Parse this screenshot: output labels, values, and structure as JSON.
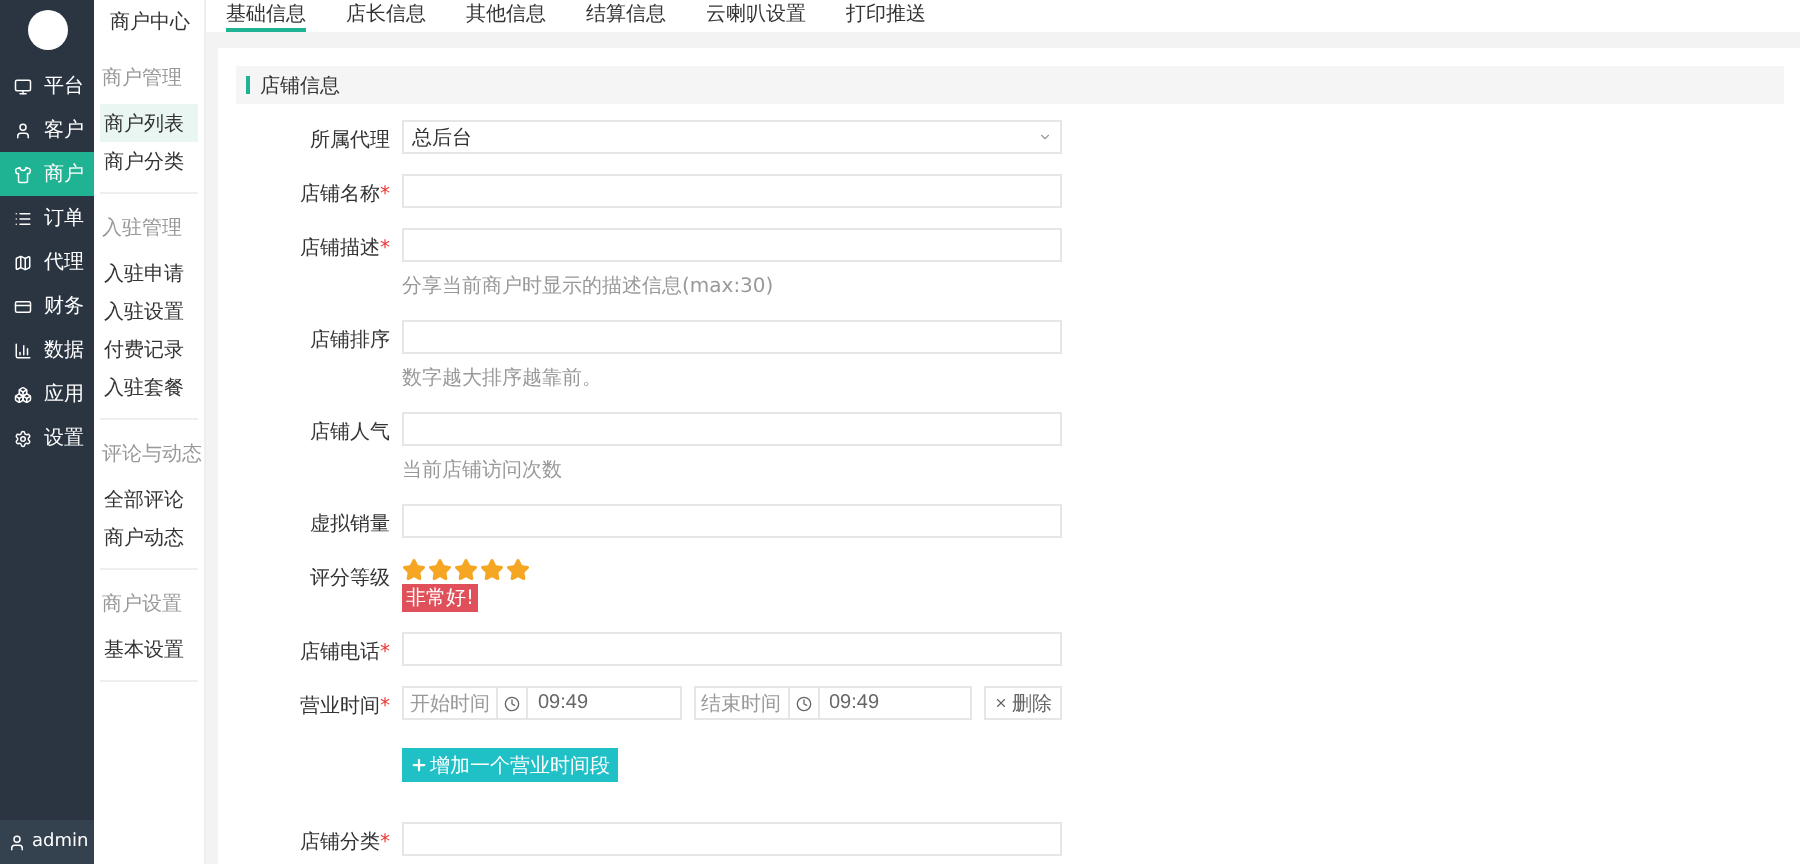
{
  "sidebar": {
    "items": [
      {
        "label": "平台",
        "selected": false
      },
      {
        "label": "客户",
        "selected": false
      },
      {
        "label": "商户",
        "selected": true
      },
      {
        "label": "订单",
        "selected": false
      },
      {
        "label": "代理",
        "selected": false
      },
      {
        "label": "财务",
        "selected": false
      },
      {
        "label": "数据",
        "selected": false
      },
      {
        "label": "应用",
        "selected": false
      },
      {
        "label": "设置",
        "selected": false
      }
    ],
    "user": "admin"
  },
  "submenu": {
    "title": "商户中心",
    "groups": [
      {
        "title": "商户管理",
        "items": [
          {
            "label": "商户列表",
            "selected": true
          },
          {
            "label": "商户分类",
            "selected": false
          }
        ]
      },
      {
        "title": "入驻管理",
        "items": [
          {
            "label": "入驻申请",
            "selected": false
          },
          {
            "label": "入驻设置",
            "selected": false
          },
          {
            "label": "付费记录",
            "selected": false
          },
          {
            "label": "入驻套餐",
            "selected": false
          }
        ]
      },
      {
        "title": "评论与动态",
        "items": [
          {
            "label": "全部评论",
            "selected": false
          },
          {
            "label": "商户动态",
            "selected": false
          }
        ]
      },
      {
        "title": "商户设置",
        "items": [
          {
            "label": "基本设置",
            "selected": false
          }
        ]
      }
    ]
  },
  "tabs": [
    {
      "label": "基础信息",
      "selected": true
    },
    {
      "label": "店长信息",
      "selected": false
    },
    {
      "label": "其他信息",
      "selected": false
    },
    {
      "label": "结算信息",
      "selected": false
    },
    {
      "label": "云喇叭设置",
      "selected": false
    },
    {
      "label": "打印推送",
      "selected": false
    }
  ],
  "section_title": "店铺信息",
  "form": [
    {
      "kind": "select",
      "label": "所属代理",
      "value": "总后台"
    },
    {
      "kind": "input",
      "label": "店铺名称",
      "required_mark": "*"
    },
    {
      "kind": "input",
      "label": "店铺描述",
      "required_mark": "*",
      "hint": "分享当前商户时显示的描述信息(max:30)"
    },
    {
      "kind": "input",
      "label": "店铺排序",
      "hint": "数字越大排序越靠前。"
    },
    {
      "kind": "input",
      "label": "店铺人气",
      "hint": "当前店铺访问次数"
    },
    {
      "kind": "input",
      "label": "虚拟销量"
    },
    {
      "kind": "stars",
      "label": "评分等级",
      "stars": 5,
      "badge": "非常好!"
    },
    {
      "kind": "input",
      "label": "店铺电话",
      "required_mark": "*"
    },
    {
      "kind": "time",
      "label": "营业时间",
      "required_mark": "*",
      "start_label": "开始时间",
      "start_value": "09:49",
      "end_label": "结束时间",
      "end_value": "09:49",
      "delete_label": "删除"
    },
    {
      "kind": "button",
      "label": "增加一个营业时间段"
    },
    {
      "kind": "input",
      "label": "店铺分类",
      "required_mark": "*"
    }
  ]
}
